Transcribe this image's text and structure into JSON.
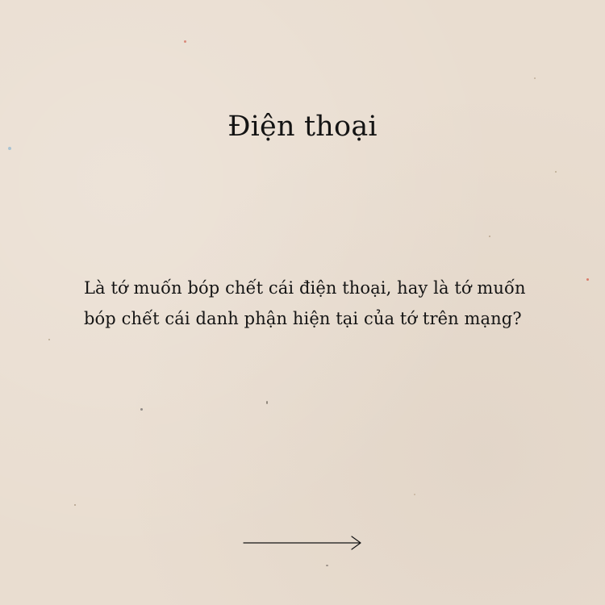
{
  "title": "Điện thoại",
  "body": {
    "line1": "Là tớ muốn bóp chết cái điện thoại, hay là tớ muốn",
    "line2": "bóp chết cái danh phận hiện tại của tớ trên mạng?"
  },
  "colors": {
    "background": "#e9ddd0",
    "text": "#141414"
  },
  "icons": {
    "next": "arrow-right-icon"
  }
}
